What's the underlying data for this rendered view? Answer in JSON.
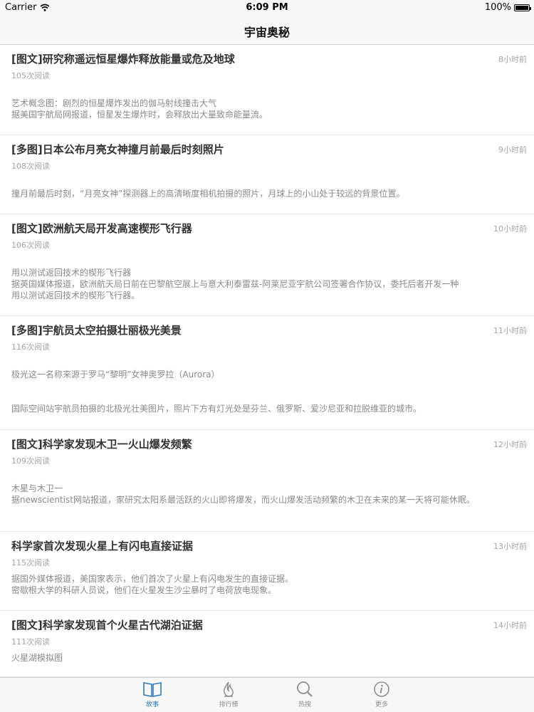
{
  "status_bar": {
    "carrier": "Carrier",
    "time": "6:09 PM",
    "battery": "100%",
    "battery_level": 1.0
  },
  "nav": {
    "title": "宇宙奥秘"
  },
  "articles": [
    {
      "title": "[图文]研究称遥远恒星爆炸释放能量或危及地球",
      "time": "8小时前",
      "reads": "105次阅读",
      "summary": [
        "艺术概念图：剧烈的恒星爆炸发出的伽马射线撞击大气",
        "据美国宇航局网报道，恒星发生爆炸时，会释放出大量致命能量流。"
      ]
    },
    {
      "title": "[多图]日本公布月亮女神撞月前最后时刻照片",
      "time": "9小时前",
      "reads": "108次阅读",
      "summary": [
        "撞月前最后时刻，“月亮女神”探测器上的高清晰度相机拍摄的照片，月球上的小山处于较远的背景位置。"
      ]
    },
    {
      "title": "[图文]欧洲航天局开发高速楔形飞行器",
      "time": "10小时前",
      "reads": "106次阅读",
      "summary": [
        "用以测试返回技术的楔形飞行器",
        "据英国媒体报道，欧洲航天局日前在巴黎航空展上与意大利泰雷兹-阿莱尼亚宇航公司签署合作协议，委托后者开发一种",
        "用以测试返回技术的楔形飞行器。"
      ]
    },
    {
      "title": "[多图]宇航员太空拍摄壮丽极光美景",
      "time": "11小时前",
      "reads": "116次阅读",
      "summary": [
        "极光这一名称来源于罗马“黎明”女神奥罗拉（Aurora）",
        "",
        "国际空间站宇航员拍摄的北极光壮美图片，照片下方有灯光处是芬兰、俄罗斯、爱沙尼亚和拉脱维亚的城市。"
      ]
    },
    {
      "title": "[图文]科学家发现木卫一火山爆发频繁",
      "time": "12小时前",
      "reads": "109次阅读",
      "summary": [
        "木星与木卫一",
        "据newscientist网站报道，家研究太阳系最活跃的火山即将爆发，而火山爆发活动频繁的木卫在未来的某一天将可能休眠。"
      ]
    },
    {
      "title": "科学家首次发现火星上有闪电直接证据",
      "time": "13小时前",
      "reads": "115次阅读",
      "summary": [
        "据国外媒体报道，美国家表示，他们首次了火星上有闪电发生的直接证据。",
        "密歇根大学的科研人员说，他们在火星发生沙尘暴时了电荷放电现象。"
      ]
    },
    {
      "title": "[图文]科学家发现首个火星古代湖泊证据",
      "time": "14小时前",
      "reads": "111次阅读",
      "summary": [
        "火星湖模拟图"
      ]
    }
  ],
  "tabs": [
    {
      "label": "故事",
      "icon": "book-icon",
      "active": true
    },
    {
      "label": "排行榜",
      "icon": "flame-icon",
      "active": false
    },
    {
      "label": "热搜",
      "icon": "search-icon",
      "active": false
    },
    {
      "label": "更多",
      "icon": "info-icon",
      "active": false
    }
  ],
  "colors": {
    "accent": "#2f7cc1",
    "inactive": "#8e8e8e"
  }
}
